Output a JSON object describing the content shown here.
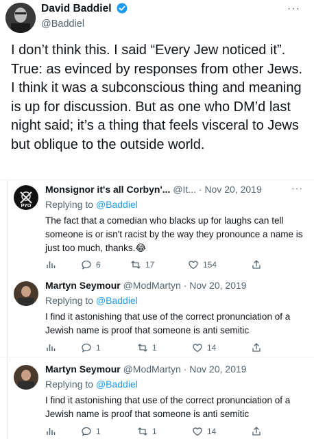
{
  "main": {
    "name": "David Baddiel",
    "handle": "@Baddiel",
    "text": "I don’t think this. I said “Every Jew noticed it”. True: as evinced by responses from other Jews. I think it was a subconscious thing and meaning is up for discussion. But as one who DM’d last night said; it’s a thing that feels visceral to Jews but oblique to the outside world.",
    "more": "···"
  },
  "replies": [
    {
      "name": "Monsignor it's all Corbyn'...",
      "meta": " @It... · Nov 20, 2019",
      "replying_prefix": "Replying to ",
      "mention": "@Baddiel",
      "text": "The fact that a comedian who blacks up for laughs can tell someone is or isn't racist by the way they pronounce a name is just too much, thanks.😂",
      "avatar_text": "PYO",
      "replies": "6",
      "retweets": "17",
      "likes": "154",
      "more": "···"
    },
    {
      "name": "Martyn Seymour",
      "meta": " @ModMartyn · Nov 20, 2019",
      "replying_prefix": "Replying to ",
      "mention": "@Baddiel",
      "text": "I find it astonishing that use of the correct pronunciation of a Jewish name is proof that someone is anti semitic",
      "replies": "1",
      "retweets": "1",
      "likes": "14"
    },
    {
      "name": "Martyn Seymour",
      "meta": " @ModMartyn · Nov 20, 2019",
      "replying_prefix": "Replying to ",
      "mention": "@Baddiel",
      "text": "I find it astonishing that use of the correct pronunciation of a Jewish name is proof that someone is anti semitic",
      "replies": "1",
      "retweets": "1",
      "likes": "14"
    }
  ],
  "icons": [
    "verified-icon",
    "views-icon",
    "reply-icon",
    "retweet-icon",
    "like-icon",
    "share-icon"
  ],
  "colors": {
    "accent": "#1d9bf0",
    "muted": "#536471",
    "text": "#0f1419"
  }
}
